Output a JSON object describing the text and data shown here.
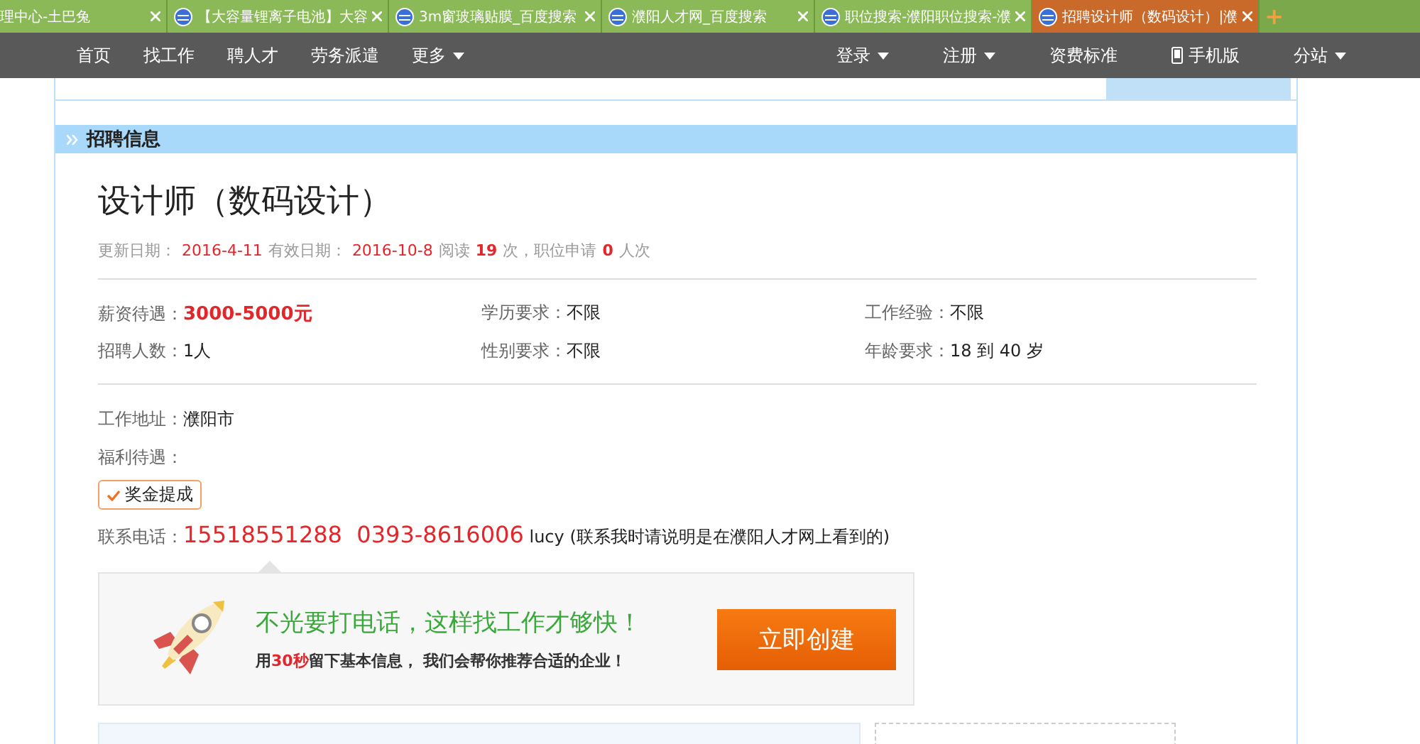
{
  "browser_tabs": [
    {
      "title": "理中心-土巴兔",
      "selected": false
    },
    {
      "title": "【大容量锂离子电池】大容",
      "selected": false
    },
    {
      "title": "3m窗玻璃贴膜_百度搜索",
      "selected": false
    },
    {
      "title": "濮阳人才网_百度搜索",
      "selected": false
    },
    {
      "title": "职位搜索-濮阳职位搜索-濮",
      "selected": false
    },
    {
      "title": "招聘设计师（数码设计）|濮",
      "selected": true
    }
  ],
  "new_tab": "+",
  "nav": {
    "left": [
      {
        "label": "首页",
        "dropdown": false
      },
      {
        "label": "找工作",
        "dropdown": false
      },
      {
        "label": "聘人才",
        "dropdown": false
      },
      {
        "label": "劳务派遣",
        "dropdown": false
      },
      {
        "label": "更多",
        "dropdown": true
      }
    ],
    "right": [
      {
        "label": "登录",
        "dropdown": true,
        "kind": "text"
      },
      {
        "label": "注册",
        "dropdown": true,
        "kind": "text"
      },
      {
        "label": "资费标准",
        "dropdown": false,
        "kind": "text"
      },
      {
        "label": "手机版",
        "dropdown": false,
        "kind": "phone"
      },
      {
        "label": "分站",
        "dropdown": true,
        "kind": "text"
      }
    ]
  },
  "section": {
    "title": "招聘信息"
  },
  "job": {
    "title": "设计师（数码设计）",
    "meta": [
      {
        "text": "更新日期：",
        "kind": "plain"
      },
      {
        "text": "2016-4-11",
        "kind": "date"
      },
      {
        "text": "有效日期：",
        "kind": "plain"
      },
      {
        "text": "2016-10-8",
        "kind": "date"
      },
      {
        "text": "阅读",
        "kind": "plain"
      },
      {
        "text": "19",
        "kind": "count"
      },
      {
        "text": "次，职位申请",
        "kind": "plain"
      },
      {
        "text": "0",
        "kind": "count"
      },
      {
        "text": "人次",
        "kind": "plain"
      }
    ],
    "details": [
      {
        "label": "薪资待遇：",
        "value": "3000-5000元",
        "highlight": true
      },
      {
        "label": "学历要求：",
        "value": "不限",
        "highlight": false
      },
      {
        "label": "工作经验：",
        "value": "不限",
        "highlight": false
      },
      {
        "label": "招聘人数：",
        "value": "1人",
        "highlight": false
      },
      {
        "label": "性别要求：",
        "value": "不限",
        "highlight": false
      },
      {
        "label": "年龄要求：",
        "value": "18 到 40 岁",
        "highlight": false
      }
    ],
    "address_label": "工作地址：",
    "address": "濮阳市",
    "welfare_label": "福利待遇：",
    "welfare_tags": [
      "奖金提成"
    ],
    "phone_label": "联系电话：",
    "phones": "15518551288  0393-8616006",
    "contact": "lucy (联系我时请说明是在濮阳人才网上看到的)"
  },
  "promo": {
    "headline": "不光要打电话，这样找工作才够快！",
    "sub_pre": "用",
    "sub_highlight": "30秒",
    "sub_post": "留下基本信息， 我们会帮你推荐合适的企业！",
    "button": "立即创建"
  }
}
